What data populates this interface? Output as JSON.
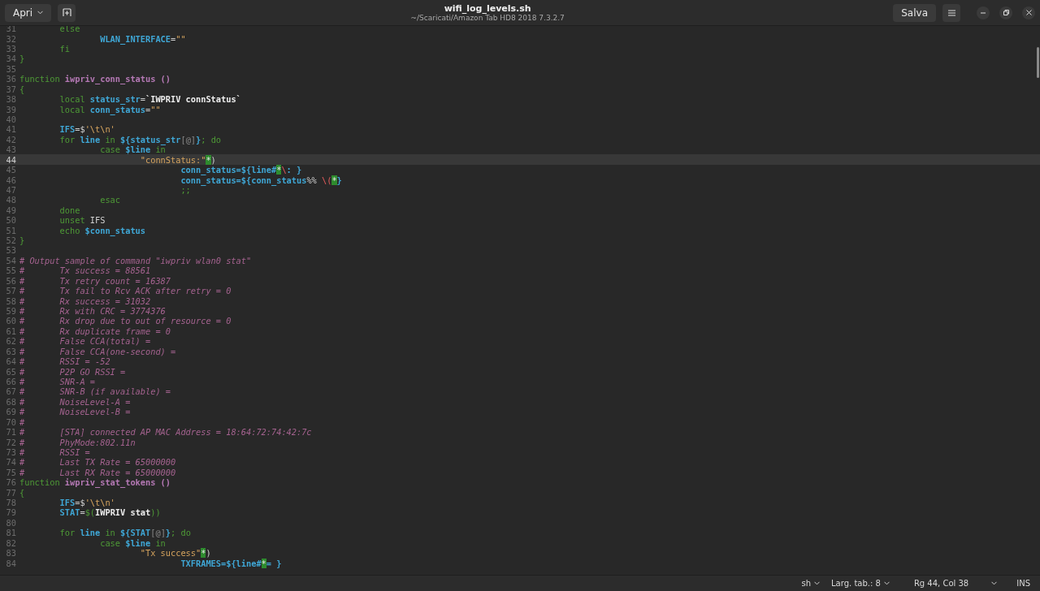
{
  "header": {
    "open_button": "Apri",
    "title": "wifi_log_levels.sh",
    "subtitle": "~/Scaricati/Amazon Tab HD8 2018 7.3.2.7",
    "save_button": "Salva"
  },
  "lines": [
    {
      "number": "31",
      "current": false,
      "tokens": [
        {
          "kind": "kw",
          "text": "\telse"
        }
      ]
    },
    {
      "number": "32",
      "current": false,
      "tokens": [
        {
          "kind": "var",
          "text": "\t\tWLAN_INTERFACE"
        },
        {
          "kind": "plain",
          "text": "="
        },
        {
          "kind": "str",
          "text": "\"\""
        }
      ]
    },
    {
      "number": "33",
      "current": false,
      "tokens": [
        {
          "kind": "kw",
          "text": "\tfi"
        }
      ]
    },
    {
      "number": "34",
      "current": false,
      "tokens": [
        {
          "kind": "kw",
          "text": "}"
        }
      ]
    },
    {
      "number": "35",
      "current": false
    },
    {
      "number": "36",
      "current": false,
      "tokens": [
        {
          "kind": "kw",
          "text": "function "
        },
        {
          "kind": "fn",
          "text": "iwpriv_conn_status ()"
        }
      ]
    },
    {
      "number": "37",
      "current": false,
      "tokens": [
        {
          "kind": "kw",
          "text": "{"
        }
      ]
    },
    {
      "number": "38",
      "current": false,
      "tokens": [
        {
          "kind": "kw",
          "text": "\tlocal "
        },
        {
          "kind": "var",
          "text": "status_str"
        },
        {
          "kind": "plain",
          "text": "="
        },
        {
          "kind": "bold",
          "text": "`IWPRIV connStatus`"
        }
      ]
    },
    {
      "number": "39",
      "current": false,
      "tokens": [
        {
          "kind": "kw",
          "text": "\tlocal "
        },
        {
          "kind": "var",
          "text": "conn_status"
        },
        {
          "kind": "plain",
          "text": "="
        },
        {
          "kind": "str",
          "text": "\"\""
        }
      ]
    },
    {
      "number": "40",
      "current": false
    },
    {
      "number": "41",
      "current": false,
      "tokens": [
        {
          "kind": "var",
          "text": "\tIFS"
        },
        {
          "kind": "plain",
          "text": "=$"
        },
        {
          "kind": "str",
          "text": "'\\t\\n'"
        }
      ]
    },
    {
      "number": "42",
      "current": false,
      "tokens": [
        {
          "kind": "kw",
          "text": "\tfor "
        },
        {
          "kind": "var",
          "text": "line "
        },
        {
          "kind": "kw",
          "text": "in "
        },
        {
          "kind": "var",
          "text": "${status_str"
        },
        {
          "kind": "dim",
          "text": "[@]"
        },
        {
          "kind": "var",
          "text": "}"
        },
        {
          "kind": "kw",
          "text": "; do"
        }
      ]
    },
    {
      "number": "43",
      "current": false,
      "tokens": [
        {
          "kind": "kw",
          "text": "\t\tcase "
        },
        {
          "kind": "var",
          "text": "$line "
        },
        {
          "kind": "kw",
          "text": "in"
        }
      ]
    },
    {
      "number": "44",
      "current": true,
      "tokens": [
        {
          "kind": "str",
          "text": "\t\t\t\"connStatus:\""
        },
        {
          "kind": "hl",
          "text": "*"
        },
        {
          "kind": "plain",
          "text": ")"
        }
      ]
    },
    {
      "number": "45",
      "current": false,
      "tokens": [
        {
          "kind": "var",
          "text": "\t\t\t\tconn_status=${line#"
        },
        {
          "kind": "hl",
          "text": "*"
        },
        {
          "kind": "special",
          "text": "\\"
        },
        {
          "kind": "var",
          "text": ": }"
        }
      ]
    },
    {
      "number": "46",
      "current": false,
      "tokens": [
        {
          "kind": "var",
          "text": "\t\t\t\tconn_status=${conn_status"
        },
        {
          "kind": "plain",
          "text": "%% "
        },
        {
          "kind": "special",
          "text": "\\("
        },
        {
          "kind": "hl",
          "text": "*"
        },
        {
          "kind": "var",
          "text": "}"
        }
      ]
    },
    {
      "number": "47",
      "current": false,
      "tokens": [
        {
          "kind": "kw",
          "text": "\t\t\t\t;;"
        }
      ]
    },
    {
      "number": "48",
      "current": false,
      "tokens": [
        {
          "kind": "kw",
          "text": "\t\tesac"
        }
      ]
    },
    {
      "number": "49",
      "current": false,
      "tokens": [
        {
          "kind": "kw",
          "text": "\tdone"
        }
      ]
    },
    {
      "number": "50",
      "current": false,
      "tokens": [
        {
          "kind": "kw",
          "text": "\tunset"
        },
        {
          "kind": "plain",
          "text": " IFS"
        }
      ]
    },
    {
      "number": "51",
      "current": false,
      "tokens": [
        {
          "kind": "kw",
          "text": "\techo "
        },
        {
          "kind": "var",
          "text": "$conn_status"
        }
      ]
    },
    {
      "number": "52",
      "current": false,
      "tokens": [
        {
          "kind": "kw",
          "text": "}"
        }
      ]
    },
    {
      "number": "53",
      "current": false
    },
    {
      "number": "54",
      "current": false,
      "tokens": [
        {
          "kind": "cmt",
          "text": "# Output sample of command \"iwpriv wlan0 stat\""
        }
      ]
    },
    {
      "number": "55",
      "current": false,
      "tokens": [
        {
          "kind": "cmt",
          "text": "#\tTx success = 88561"
        }
      ]
    },
    {
      "number": "56",
      "current": false,
      "tokens": [
        {
          "kind": "cmt",
          "text": "#\tTx retry count = 16387"
        }
      ]
    },
    {
      "number": "57",
      "current": false,
      "tokens": [
        {
          "kind": "cmt",
          "text": "#\tTx fail to Rcv ACK after retry = 0"
        }
      ]
    },
    {
      "number": "58",
      "current": false,
      "tokens": [
        {
          "kind": "cmt",
          "text": "#\tRx success = 31032"
        }
      ]
    },
    {
      "number": "59",
      "current": false,
      "tokens": [
        {
          "kind": "cmt",
          "text": "#\tRx with CRC = 3774376"
        }
      ]
    },
    {
      "number": "60",
      "current": false,
      "tokens": [
        {
          "kind": "cmt",
          "text": "#\tRx drop due to out of resource = 0"
        }
      ]
    },
    {
      "number": "61",
      "current": false,
      "tokens": [
        {
          "kind": "cmt",
          "text": "#\tRx duplicate frame = 0"
        }
      ]
    },
    {
      "number": "62",
      "current": false,
      "tokens": [
        {
          "kind": "cmt",
          "text": "#\tFalse CCA(total) ="
        }
      ]
    },
    {
      "number": "63",
      "current": false,
      "tokens": [
        {
          "kind": "cmt",
          "text": "#\tFalse CCA(one-second) ="
        }
      ]
    },
    {
      "number": "64",
      "current": false,
      "tokens": [
        {
          "kind": "cmt",
          "text": "#\tRSSI = -52"
        }
      ]
    },
    {
      "number": "65",
      "current": false,
      "tokens": [
        {
          "kind": "cmt",
          "text": "#\tP2P GO RSSI ="
        }
      ]
    },
    {
      "number": "66",
      "current": false,
      "tokens": [
        {
          "kind": "cmt",
          "text": "#\tSNR-A ="
        }
      ]
    },
    {
      "number": "67",
      "current": false,
      "tokens": [
        {
          "kind": "cmt",
          "text": "#\tSNR-B (if available) ="
        }
      ]
    },
    {
      "number": "68",
      "current": false,
      "tokens": [
        {
          "kind": "cmt",
          "text": "#\tNoiseLevel-A ="
        }
      ]
    },
    {
      "number": "69",
      "current": false,
      "tokens": [
        {
          "kind": "cmt",
          "text": "#\tNoiseLevel-B ="
        }
      ]
    },
    {
      "number": "70",
      "current": false,
      "tokens": [
        {
          "kind": "cmt",
          "text": "#"
        }
      ]
    },
    {
      "number": "71",
      "current": false,
      "tokens": [
        {
          "kind": "cmt",
          "text": "#\t[STA] connected AP MAC Address = 18:64:72:74:42:7c"
        }
      ]
    },
    {
      "number": "72",
      "current": false,
      "tokens": [
        {
          "kind": "cmt",
          "text": "#\tPhyMode:802.11n"
        }
      ]
    },
    {
      "number": "73",
      "current": false,
      "tokens": [
        {
          "kind": "cmt",
          "text": "#\tRSSI ="
        }
      ]
    },
    {
      "number": "74",
      "current": false,
      "tokens": [
        {
          "kind": "cmt",
          "text": "#\tLast TX Rate = 65000000"
        }
      ]
    },
    {
      "number": "75",
      "current": false,
      "tokens": [
        {
          "kind": "cmt",
          "text": "#\tLast RX Rate = 65000000"
        }
      ]
    },
    {
      "number": "76",
      "current": false,
      "tokens": [
        {
          "kind": "kw",
          "text": "function "
        },
        {
          "kind": "fn",
          "text": "iwpriv_stat_tokens ()"
        }
      ]
    },
    {
      "number": "77",
      "current": false,
      "tokens": [
        {
          "kind": "kw",
          "text": "{"
        }
      ]
    },
    {
      "number": "78",
      "current": false,
      "tokens": [
        {
          "kind": "var",
          "text": "\tIFS"
        },
        {
          "kind": "plain",
          "text": "=$"
        },
        {
          "kind": "str",
          "text": "'\\t\\n'"
        }
      ]
    },
    {
      "number": "79",
      "current": false,
      "tokens": [
        {
          "kind": "var",
          "text": "\tSTAT"
        },
        {
          "kind": "plain",
          "text": "="
        },
        {
          "kind": "kw",
          "text": "$("
        },
        {
          "kind": "bold",
          "text": "IWPRIV stat"
        },
        {
          "kind": "kw",
          "text": "))"
        }
      ]
    },
    {
      "number": "80",
      "current": false
    },
    {
      "number": "81",
      "current": false,
      "tokens": [
        {
          "kind": "kw",
          "text": "\tfor "
        },
        {
          "kind": "var",
          "text": "line "
        },
        {
          "kind": "kw",
          "text": "in "
        },
        {
          "kind": "var",
          "text": "${STAT"
        },
        {
          "kind": "dim",
          "text": "[@]"
        },
        {
          "kind": "var",
          "text": "}"
        },
        {
          "kind": "kw",
          "text": "; do"
        }
      ]
    },
    {
      "number": "82",
      "current": false,
      "tokens": [
        {
          "kind": "kw",
          "text": "\t\tcase "
        },
        {
          "kind": "var",
          "text": "$line "
        },
        {
          "kind": "kw",
          "text": "in"
        }
      ]
    },
    {
      "number": "83",
      "current": false,
      "tokens": [
        {
          "kind": "str",
          "text": "\t\t\t\"Tx success\""
        },
        {
          "kind": "hl",
          "text": "*"
        },
        {
          "kind": "plain",
          "text": ")"
        }
      ]
    },
    {
      "number": "84",
      "current": false,
      "tokens": [
        {
          "kind": "var",
          "text": "\t\t\t\tTXFRAMES=${line#"
        },
        {
          "kind": "hl",
          "text": "*"
        },
        {
          "kind": "var",
          "text": "= }"
        }
      ]
    }
  ],
  "status_bar": {
    "language": "sh",
    "tab_width": "Larg. tab.: 8",
    "position": "Rg 44, Col 38",
    "mode": "INS"
  }
}
